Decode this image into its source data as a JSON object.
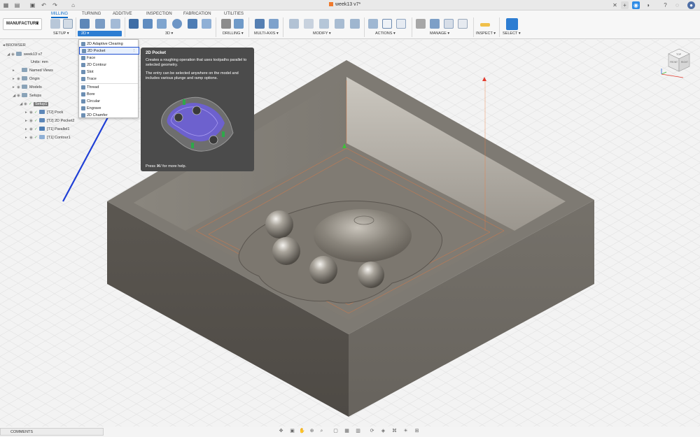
{
  "document": {
    "title": "week13 v7*"
  },
  "workspace": {
    "label": "MANUFACTURE"
  },
  "tabs": [
    "MILLING",
    "TURNING",
    "ADDITIVE",
    "INSPECTION",
    "FABRICATION",
    "UTILITIES"
  ],
  "groups": {
    "setup": "SETUP",
    "two_d": "2D",
    "three_d": "3D",
    "drilling": "DRILLING",
    "multi_axis": "MULTI-AXIS",
    "modify": "MODIFY",
    "actions": "ACTIONS",
    "manage": "MANAGE",
    "inspect": "INSPECT",
    "select": "SELECT"
  },
  "browser": {
    "header": "BROWSER",
    "root": "week13 v7",
    "units": "Units: mm",
    "named_views": "Named Views",
    "origin": "Origin",
    "models": "Models",
    "setups": "Setups",
    "setup1": "Setup1",
    "ops": [
      "[T2] Pock",
      "[T2] 2D Pocket2",
      "[T1] Parallel1",
      "[T1] Contour1"
    ]
  },
  "menu": {
    "items": [
      "2D Adaptive Clearing",
      "2D Pocket",
      "Face",
      "2D Contour",
      "Slot",
      "Trace",
      "Thread",
      "Bore",
      "Circular",
      "Engrave",
      "2D Chamfer"
    ],
    "selected": "2D Pocket"
  },
  "tooltip": {
    "title": "2D Pocket",
    "desc1": "Creates a roughing operation that uses toolpaths parallel to selected geometry.",
    "desc2": "The entry can be selected anywhere on the model and includes various plunge and ramp options.",
    "footer": "Press ⌘/ for more help."
  },
  "comments": {
    "label": "COMMENTS"
  },
  "viewcube": {
    "top": "TOP",
    "front": "FRONT",
    "right": "RIGHT"
  },
  "colors": {
    "accent": "#0b6bc9",
    "selection": "#1f4fd1",
    "annotation_arrow": "#1f3fd6",
    "tooltip_bg": "#4b4b4b"
  }
}
